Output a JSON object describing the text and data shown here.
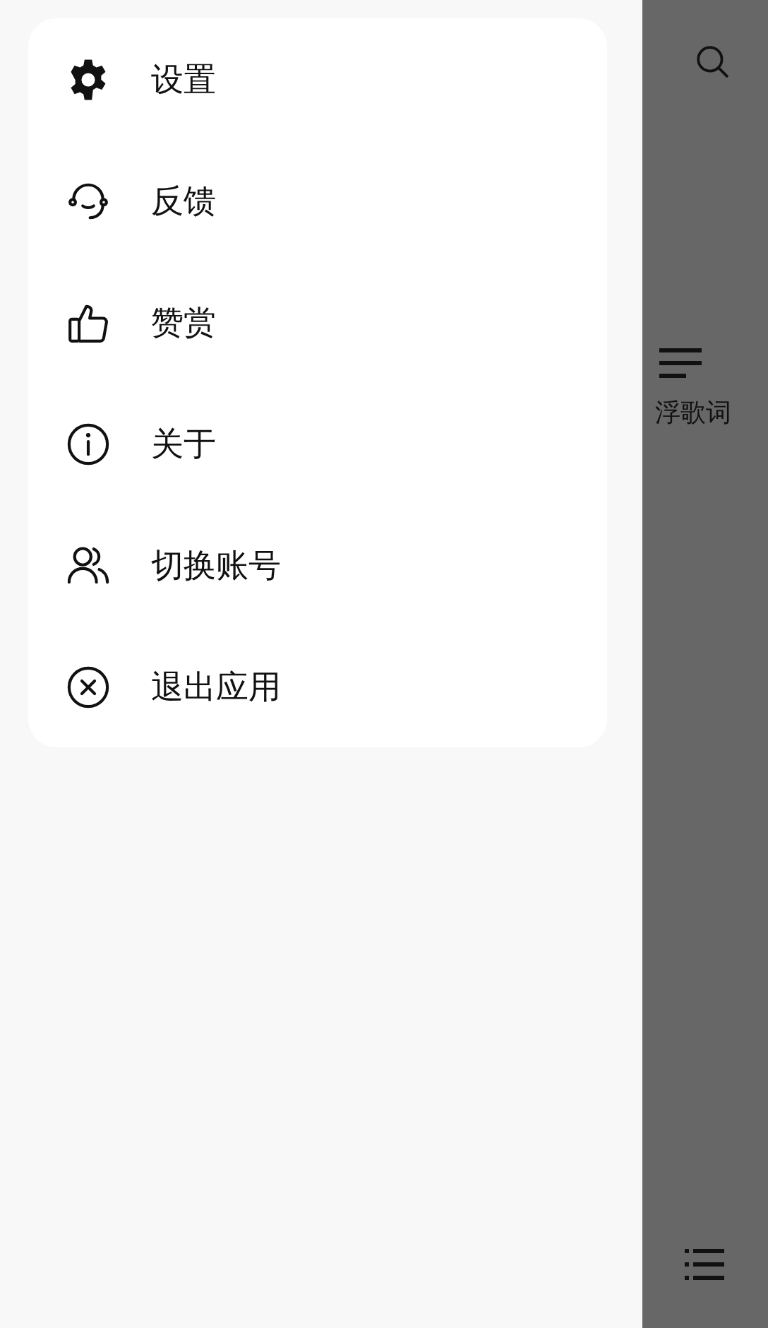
{
  "drawer": {
    "menu": [
      {
        "kind": "settings",
        "label": "设置"
      },
      {
        "kind": "feedback",
        "label": "反馈"
      },
      {
        "kind": "like",
        "label": "赞赏"
      },
      {
        "kind": "about",
        "label": "关于"
      },
      {
        "kind": "account",
        "label": "切换账号"
      },
      {
        "kind": "exit",
        "label": "退出应用"
      }
    ]
  },
  "background": {
    "lyrics_label": "浮歌词"
  }
}
